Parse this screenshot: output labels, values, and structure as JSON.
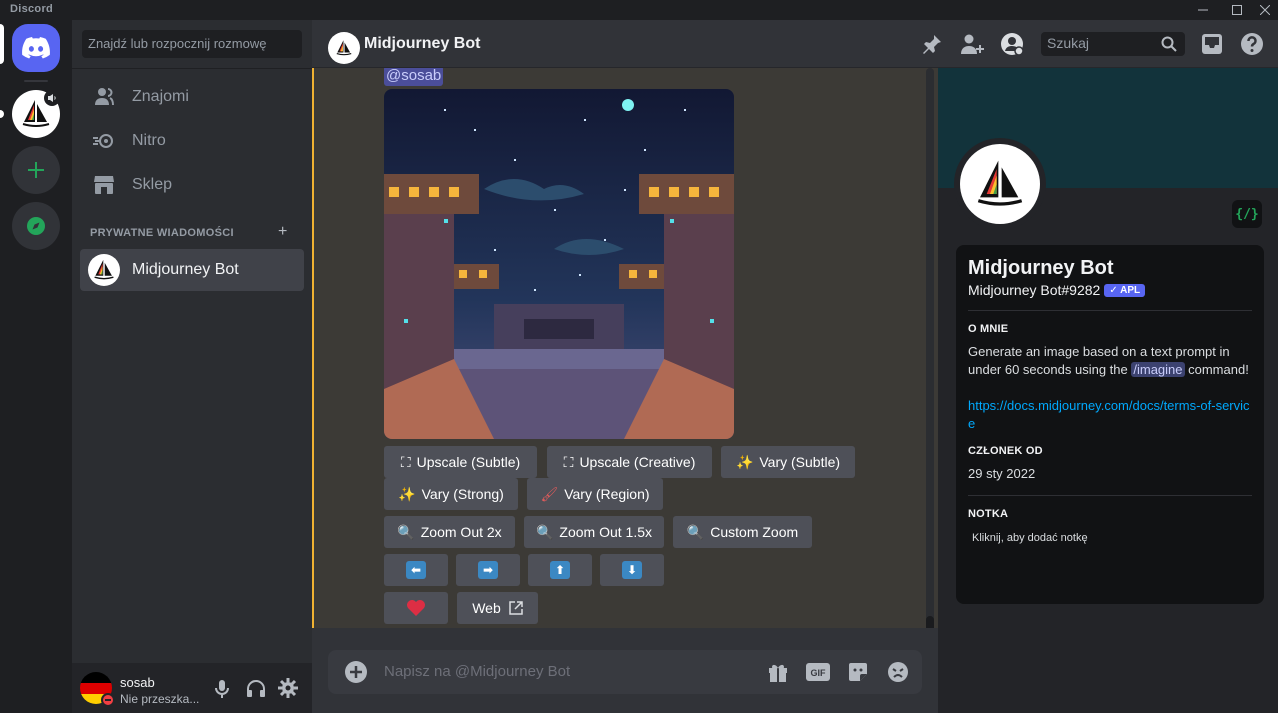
{
  "window": {
    "app_name": "Discord"
  },
  "sidebar": {
    "search_placeholder": "Znajdź lub rozpocznij rozmowę",
    "nav": [
      {
        "label": "Znajomi",
        "icon": "friends-icon"
      },
      {
        "label": "Nitro",
        "icon": "nitro-icon"
      },
      {
        "label": "Sklep",
        "icon": "shop-icon"
      }
    ],
    "dm_header": "PRYWATNE WIADOMOŚCI",
    "dm_items": [
      {
        "label": "Midjourney Bot"
      }
    ]
  },
  "user_panel": {
    "username": "sosab",
    "status": "Nie przeszka..."
  },
  "header": {
    "title": "Midjourney Bot",
    "search_placeholder": "Szukaj"
  },
  "chat": {
    "mention": "@sosab",
    "buttons_row1": [
      {
        "label": "Upscale (Subtle)",
        "icon": "upscale-icon"
      },
      {
        "label": "Upscale (Creative)",
        "icon": "upscale-icon"
      },
      {
        "label": "Vary (Subtle)",
        "icon": "sparkle-wand-icon"
      }
    ],
    "buttons_row2": [
      {
        "label": "Vary (Strong)",
        "icon": "sparkle-wand-icon"
      },
      {
        "label": "Vary (Region)",
        "icon": "paintbrush-icon"
      }
    ],
    "buttons_row3": [
      {
        "label": "Zoom Out 2x",
        "icon": "magnifier-icon"
      },
      {
        "label": "Zoom Out 1.5x",
        "icon": "magnifier-icon"
      },
      {
        "label": "Custom Zoom",
        "icon": "magnifier-icon"
      }
    ],
    "pan_buttons": [
      "pan-left",
      "pan-right",
      "pan-up",
      "pan-down"
    ],
    "web_label": "Web"
  },
  "composer": {
    "placeholder": "Napisz na @Midjourney Bot"
  },
  "profile": {
    "name": "Midjourney Bot",
    "tag": "Midjourney Bot#9282",
    "badge": "APL",
    "about_header": "O MNIE",
    "about_text_1": "Generate an image based on a text prompt in under 60 seconds using the",
    "about_command": "/imagine",
    "about_text_2": "command!",
    "link": "https://docs.midjourney.com/docs/terms-of-service",
    "member_header": "CZŁONEK OD",
    "member_since": "29 sty 2022",
    "note_header": "NOTKA",
    "note_placeholder": "Kliknij, aby dodać notkę",
    "dev_badge": "{/}"
  },
  "colors": {
    "accent": "#5865f2",
    "online": "#23a55a",
    "highlight": "#f0b232"
  }
}
